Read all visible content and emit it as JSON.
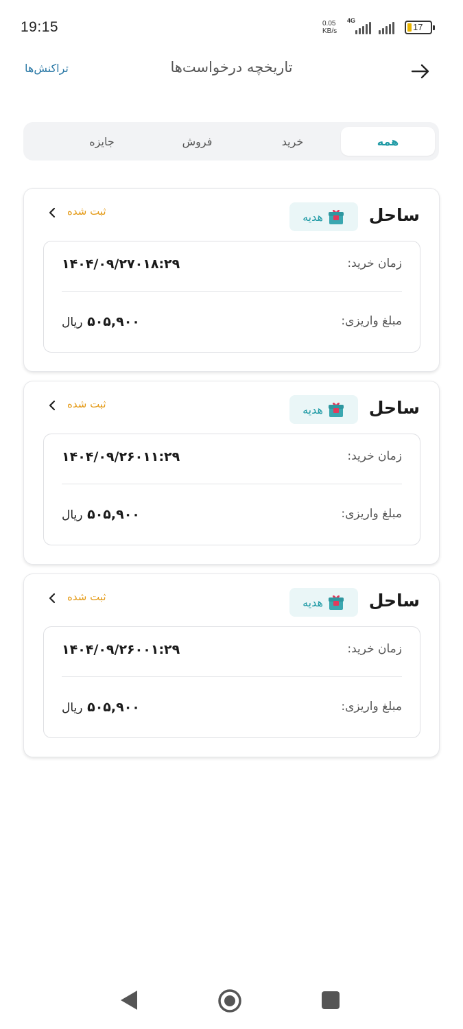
{
  "status_bar": {
    "time": "19:15",
    "net_speed_value": "0.05",
    "net_speed_unit": "KB/s",
    "network_type": "4G",
    "battery_level": "17"
  },
  "header": {
    "title": "تاریخچه درخواست‌ها",
    "transactions_link": "تراکنش‌ها",
    "back_icon": "arrow-right-icon"
  },
  "tabs": [
    {
      "label": "همه",
      "active": true
    },
    {
      "label": "خرید",
      "active": false
    },
    {
      "label": "فروش",
      "active": false
    },
    {
      "label": "جایزه",
      "active": false
    }
  ],
  "cards": [
    {
      "name": "ساحل",
      "badge": "هدیه",
      "status": "ثبت شده",
      "purchase_time_label": "زمان خرید:",
      "purchase_time": "۱۴۰۴/۰۹/۲۷۰۱۸:۲۹",
      "amount_label": "مبلغ واریزی:",
      "amount": "۵۰۵,۹۰۰",
      "currency": "ریال"
    },
    {
      "name": "ساحل",
      "badge": "هدیه",
      "status": "ثبت شده",
      "purchase_time_label": "زمان خرید:",
      "purchase_time": "۱۴۰۴/۰۹/۲۶۰۱۱:۲۹",
      "amount_label": "مبلغ واریزی:",
      "amount": "۵۰۵,۹۰۰",
      "currency": "ریال"
    },
    {
      "name": "ساحل",
      "badge": "هدیه",
      "status": "ثبت شده",
      "purchase_time_label": "زمان خرید:",
      "purchase_time": "۱۴۰۴/۰۹/۲۶۰۰۱:۲۹",
      "amount_label": "مبلغ واریزی:",
      "amount": "۵۰۵,۹۰۰",
      "currency": "ریال"
    }
  ],
  "colors": {
    "accent": "#1f9aa5",
    "status_orange": "#e49a16",
    "link_blue": "#2b79a6"
  },
  "nav_bar": {
    "back_icon": "triangle-back-icon",
    "home_icon": "circle-home-icon",
    "recent_icon": "square-recents-icon"
  }
}
